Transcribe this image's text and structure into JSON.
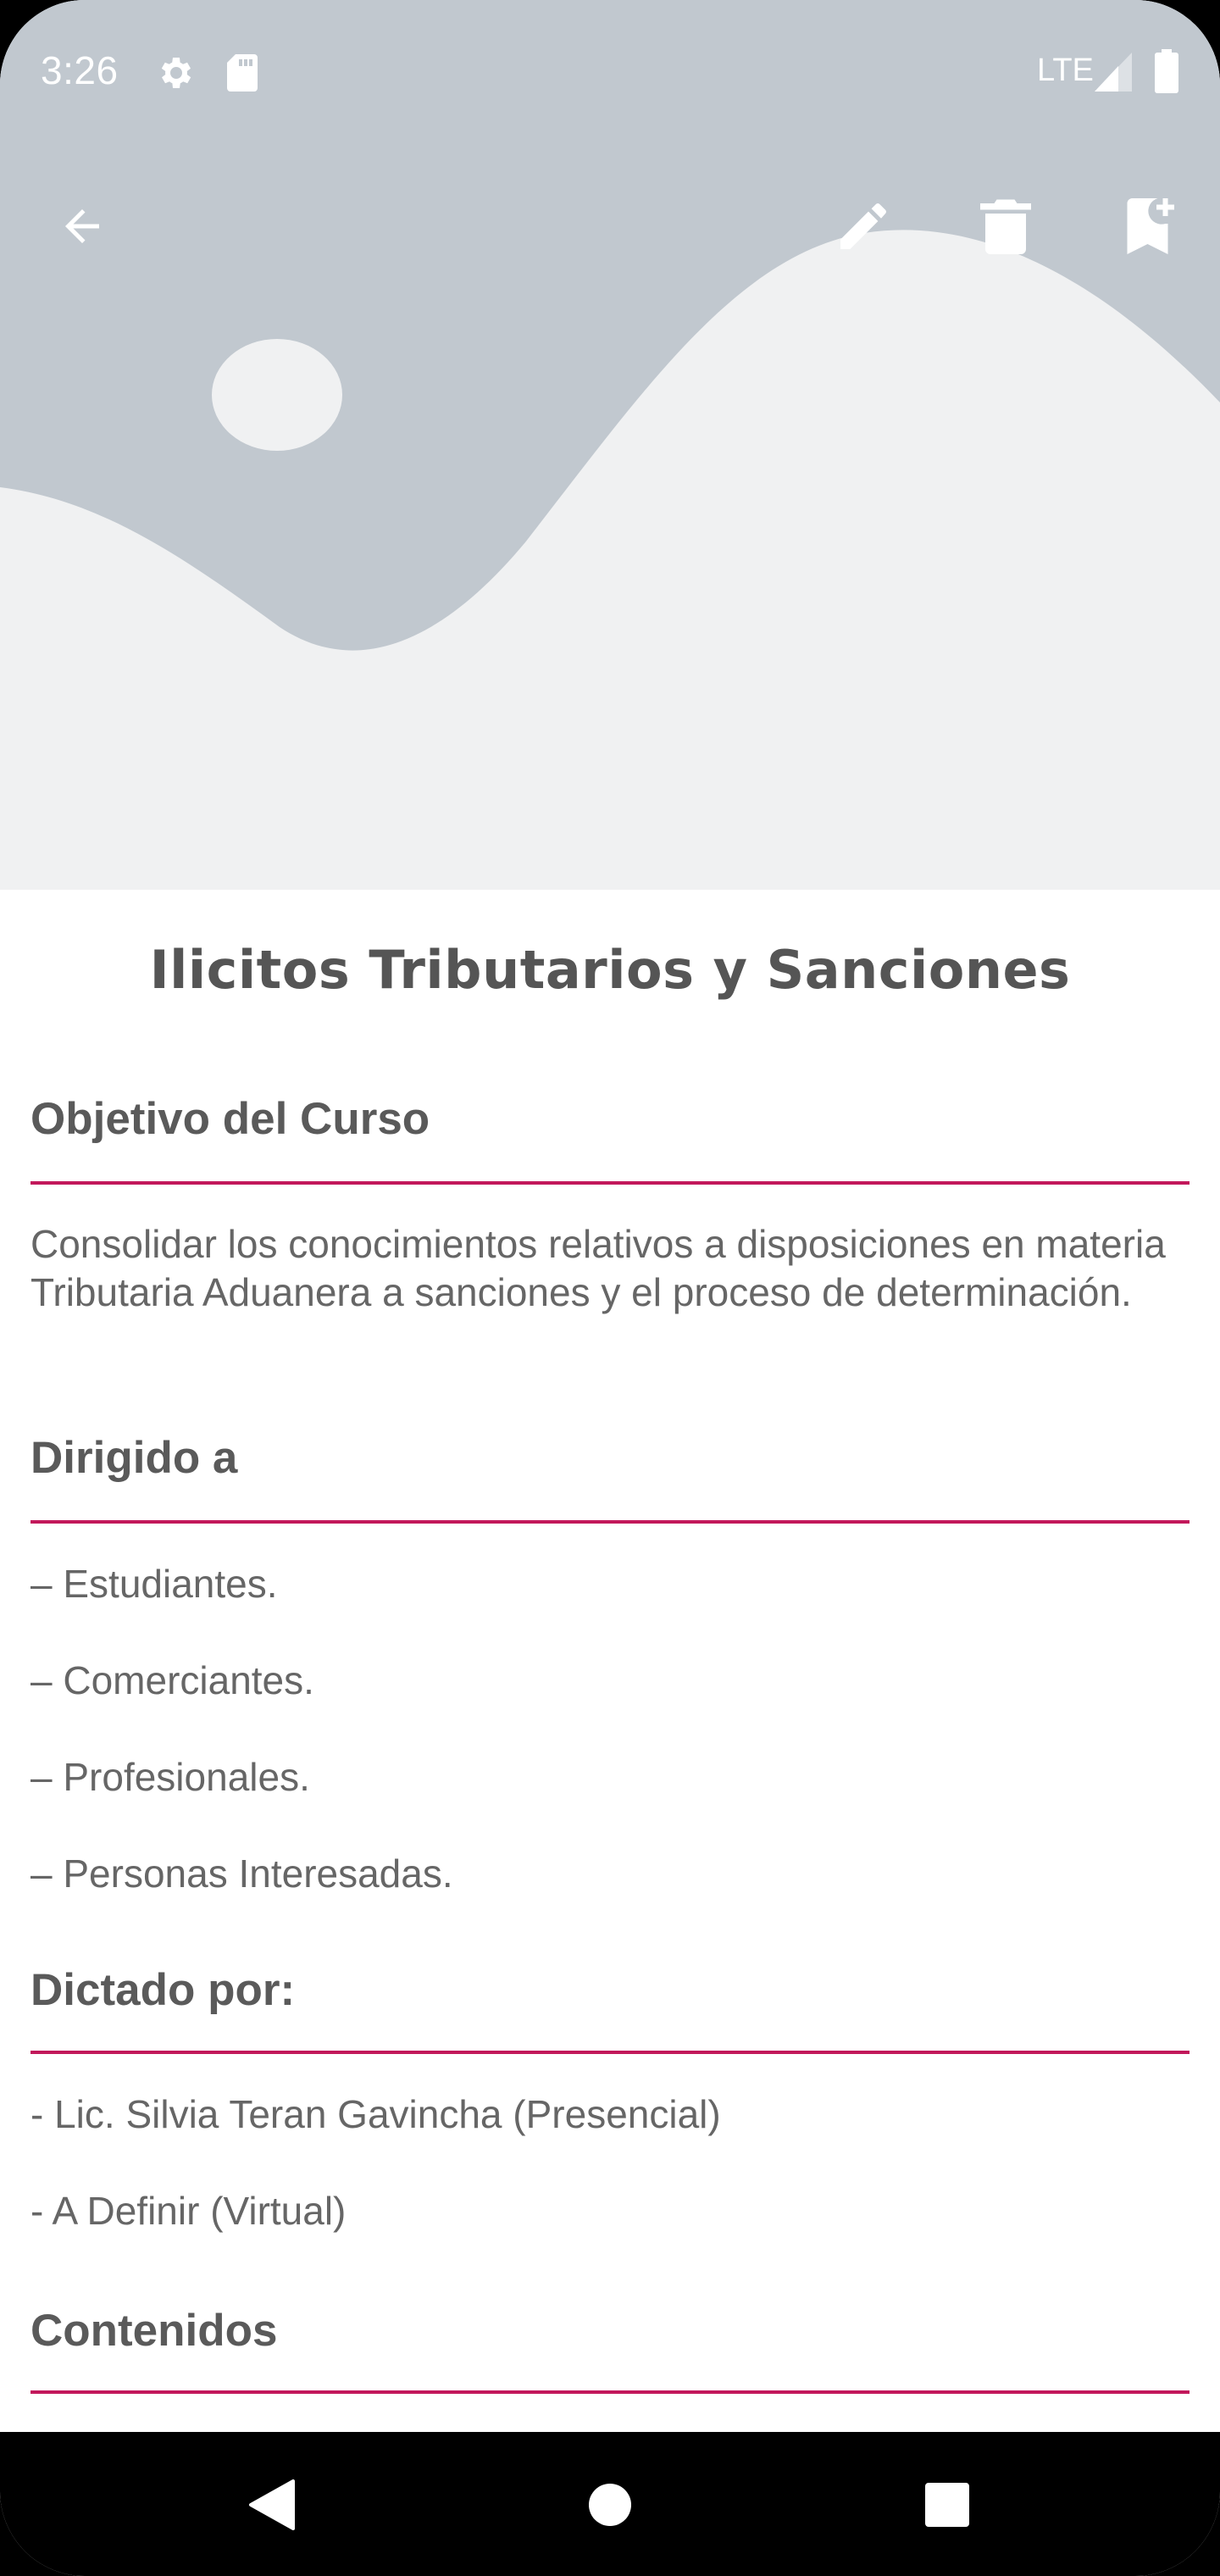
{
  "status_bar": {
    "time": "3:26",
    "network": "LTE",
    "icons": [
      "settings-icon",
      "sd-card-icon",
      "signal-icon",
      "battery-icon"
    ]
  },
  "app_bar": {
    "actions": [
      "back-arrow-icon",
      "edit-pencil-icon",
      "delete-trash-icon",
      "bookmark-add-icon"
    ]
  },
  "course": {
    "title": "Ilicitos Tributarios y Sanciones",
    "sections": {
      "objective": {
        "heading": "Objetivo del Curso",
        "text": "Consolidar los conocimientos relativos a disposiciones en materia Tributaria Aduanera a sanciones y el proceso de determinación."
      },
      "audience": {
        "heading": "Dirigido a",
        "items": [
          "– Estudiantes.",
          "– Comerciantes.",
          "– Profesionales.",
          "– Personas Interesadas."
        ]
      },
      "instructors": {
        "heading": "Dictado por:",
        "items": [
          "- Lic. Silvia Teran Gavincha (Presencial)",
          "- A Definir (Virtual)"
        ]
      },
      "contents": {
        "heading": "Contenidos"
      }
    }
  },
  "nav_bar": {
    "buttons": [
      "back-triangle-icon",
      "home-circle-icon",
      "recents-square-icon"
    ]
  },
  "colors": {
    "accent_rule": "#c2185b",
    "hero_background": "#c1c8cf",
    "hero_foreground": "#f0f1f2",
    "text_heading": "#5a5a5a",
    "text_body": "#666666"
  }
}
